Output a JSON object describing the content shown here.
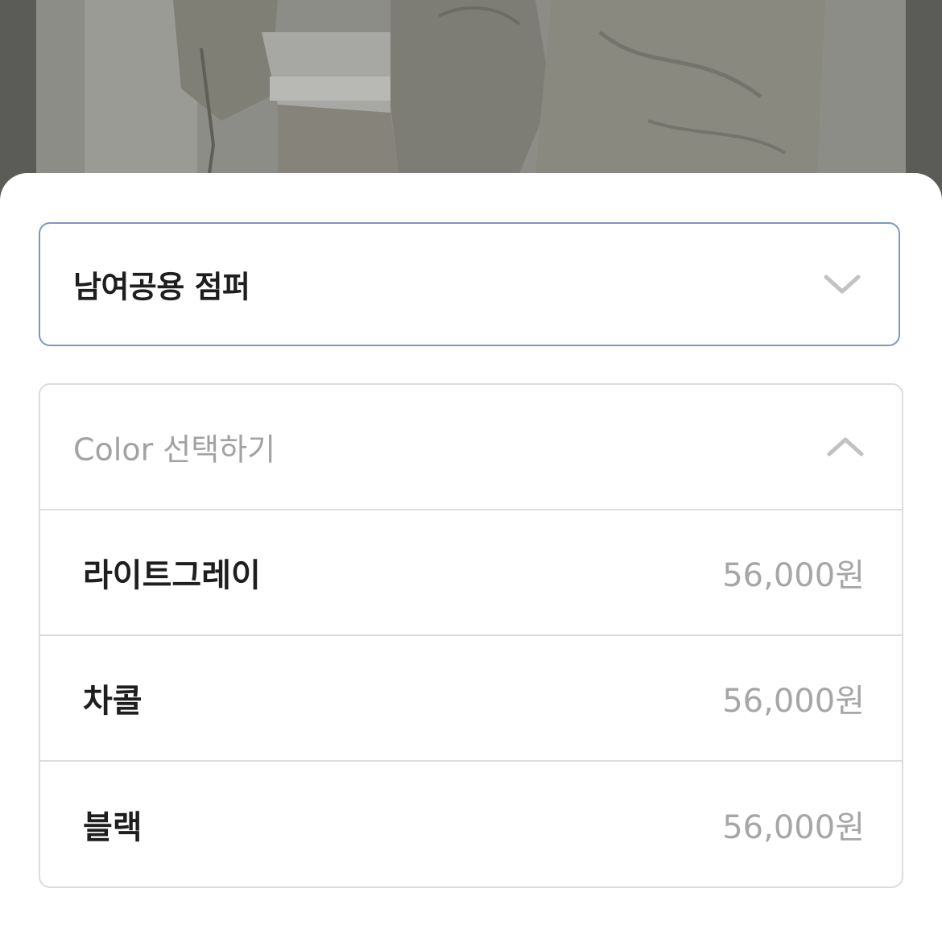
{
  "product_select": {
    "selected_label": "남여공용 점퍼",
    "chevron_icon": "chevron-down-icon"
  },
  "color_select": {
    "placeholder": "Color 선택하기",
    "chevron_icon": "chevron-up-icon",
    "options": [
      {
        "name": "라이트그레이",
        "price": "56,000원"
      },
      {
        "name": "차콜",
        "price": "56,000원"
      },
      {
        "name": "블랙",
        "price": "56,000원"
      }
    ]
  },
  "colors": {
    "focus_border": "#7d97c4",
    "divider": "#dcdcdc",
    "price_text": "#a6a6a6",
    "placeholder_text": "#a2a2a2"
  }
}
